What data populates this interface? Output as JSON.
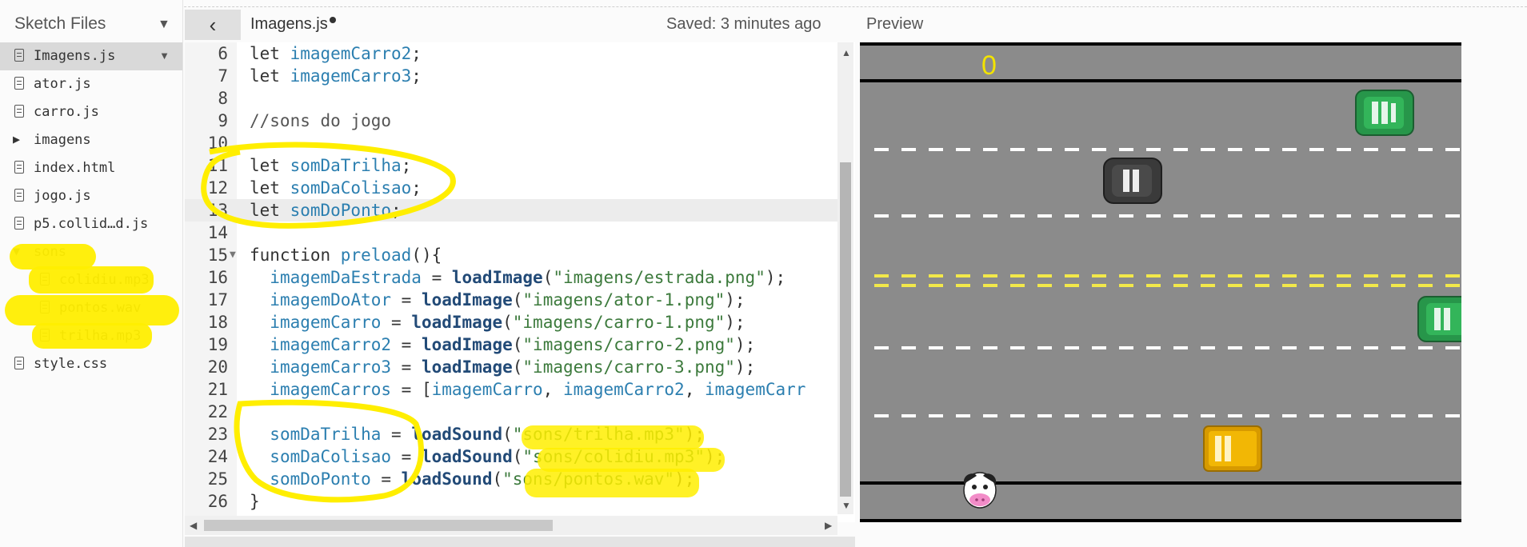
{
  "sidebar": {
    "title": "Sketch Files",
    "items": [
      {
        "label": "Imagens.js",
        "type": "file",
        "active": true
      },
      {
        "label": "ator.js",
        "type": "file"
      },
      {
        "label": "carro.js",
        "type": "file"
      },
      {
        "label": "imagens",
        "type": "folder",
        "expanded": false
      },
      {
        "label": "index.html",
        "type": "file"
      },
      {
        "label": "jogo.js",
        "type": "file"
      },
      {
        "label": "p5.collid…d.js",
        "type": "file"
      },
      {
        "label": "sons",
        "type": "folder",
        "expanded": true
      },
      {
        "label": "colidiu.mp3",
        "type": "file",
        "indent": 1
      },
      {
        "label": "pontos.wav",
        "type": "file",
        "indent": 1
      },
      {
        "label": "trilha.mp3",
        "type": "file",
        "indent": 1
      },
      {
        "label": "style.css",
        "type": "file"
      }
    ]
  },
  "editor": {
    "file_name": "Imagens.js",
    "saved_status": "Saved: 3 minutes ago",
    "current_line": 13,
    "lines": [
      {
        "n": "6",
        "tokens": [
          [
            "kw",
            "let "
          ],
          [
            "var",
            "imagemCarro2"
          ],
          [
            "pun",
            ";"
          ]
        ]
      },
      {
        "n": "7",
        "tokens": [
          [
            "kw",
            "let "
          ],
          [
            "var",
            "imagemCarro3"
          ],
          [
            "pun",
            ";"
          ]
        ]
      },
      {
        "n": "8",
        "tokens": []
      },
      {
        "n": "9",
        "tokens": [
          [
            "cmt",
            "//sons do jogo"
          ]
        ]
      },
      {
        "n": "10",
        "tokens": []
      },
      {
        "n": "11",
        "tokens": [
          [
            "kw",
            "let "
          ],
          [
            "var",
            "somDaTrilha"
          ],
          [
            "pun",
            ";"
          ]
        ]
      },
      {
        "n": "12",
        "tokens": [
          [
            "kw",
            "let "
          ],
          [
            "var",
            "somDaColisao"
          ],
          [
            "pun",
            ";"
          ]
        ]
      },
      {
        "n": "13",
        "tokens": [
          [
            "kw",
            "let "
          ],
          [
            "var",
            "somDoPonto"
          ],
          [
            "pun",
            ";"
          ]
        ]
      },
      {
        "n": "14",
        "tokens": []
      },
      {
        "n": "15",
        "fold": true,
        "tokens": [
          [
            "kw",
            "function "
          ],
          [
            "var",
            "preload"
          ],
          [
            "pun",
            "(){"
          ]
        ]
      },
      {
        "n": "16",
        "tokens": [
          [
            "pun",
            "  "
          ],
          [
            "var",
            "imagemDaEstrada"
          ],
          [
            "pun",
            " = "
          ],
          [
            "fn",
            "loadImage"
          ],
          [
            "pun",
            "("
          ],
          [
            "str",
            "\"imagens/estrada.png\""
          ],
          [
            "pun",
            ");"
          ]
        ]
      },
      {
        "n": "17",
        "tokens": [
          [
            "pun",
            "  "
          ],
          [
            "var",
            "imagemDoAtor"
          ],
          [
            "pun",
            " = "
          ],
          [
            "fn",
            "loadImage"
          ],
          [
            "pun",
            "("
          ],
          [
            "str",
            "\"imagens/ator-1.png\""
          ],
          [
            "pun",
            ");"
          ]
        ]
      },
      {
        "n": "18",
        "tokens": [
          [
            "pun",
            "  "
          ],
          [
            "var",
            "imagemCarro"
          ],
          [
            "pun",
            " = "
          ],
          [
            "fn",
            "loadImage"
          ],
          [
            "pun",
            "("
          ],
          [
            "str",
            "\"imagens/carro-1.png\""
          ],
          [
            "pun",
            ");"
          ]
        ]
      },
      {
        "n": "19",
        "tokens": [
          [
            "pun",
            "  "
          ],
          [
            "var",
            "imagemCarro2"
          ],
          [
            "pun",
            " = "
          ],
          [
            "fn",
            "loadImage"
          ],
          [
            "pun",
            "("
          ],
          [
            "str",
            "\"imagens/carro-2.png\""
          ],
          [
            "pun",
            ");"
          ]
        ]
      },
      {
        "n": "20",
        "tokens": [
          [
            "pun",
            "  "
          ],
          [
            "var",
            "imagemCarro3"
          ],
          [
            "pun",
            " = "
          ],
          [
            "fn",
            "loadImage"
          ],
          [
            "pun",
            "("
          ],
          [
            "str",
            "\"imagens/carro-3.png\""
          ],
          [
            "pun",
            ");"
          ]
        ]
      },
      {
        "n": "21",
        "tokens": [
          [
            "pun",
            "  "
          ],
          [
            "var",
            "imagemCarros"
          ],
          [
            "pun",
            " = ["
          ],
          [
            "var",
            "imagemCarro"
          ],
          [
            "pun",
            ", "
          ],
          [
            "var",
            "imagemCarro2"
          ],
          [
            "pun",
            ", "
          ],
          [
            "var",
            "imagemCarr"
          ]
        ]
      },
      {
        "n": "22",
        "tokens": []
      },
      {
        "n": "23",
        "tokens": [
          [
            "pun",
            "  "
          ],
          [
            "var",
            "somDaTrilha"
          ],
          [
            "pun",
            " = "
          ],
          [
            "fn",
            "loadSound"
          ],
          [
            "pun",
            "("
          ],
          [
            "str",
            "\"sons/trilha.mp3\""
          ],
          [
            "pun",
            ");"
          ]
        ]
      },
      {
        "n": "24",
        "tokens": [
          [
            "pun",
            "  "
          ],
          [
            "var",
            "somDaColisao"
          ],
          [
            "pun",
            " = "
          ],
          [
            "fn",
            "loadSound"
          ],
          [
            "pun",
            "("
          ],
          [
            "str",
            "\"sons/colidiu.mp3\""
          ],
          [
            "pun",
            ");"
          ]
        ]
      },
      {
        "n": "25",
        "tokens": [
          [
            "pun",
            "  "
          ],
          [
            "var",
            "somDoPonto"
          ],
          [
            "pun",
            " = "
          ],
          [
            "fn",
            "loadSound"
          ],
          [
            "pun",
            "("
          ],
          [
            "str",
            "\"sons/pontos.wav\""
          ],
          [
            "pun",
            ");"
          ]
        ]
      },
      {
        "n": "26",
        "tokens": [
          [
            "pun",
            "}"
          ]
        ]
      }
    ]
  },
  "preview": {
    "title": "Preview",
    "score": "0",
    "colors": {
      "road": "#8b8b8b",
      "lane": "#ffffff",
      "center_lane": "#f2e84a",
      "score": "#f2e300",
      "car_green": "#2fa84f",
      "car_black": "#444444",
      "car_yellow": "#f2b705"
    }
  },
  "icons": {
    "collapse": "chevron-left-icon",
    "file": "file-icon",
    "folder": "folder-triangle-icon"
  }
}
